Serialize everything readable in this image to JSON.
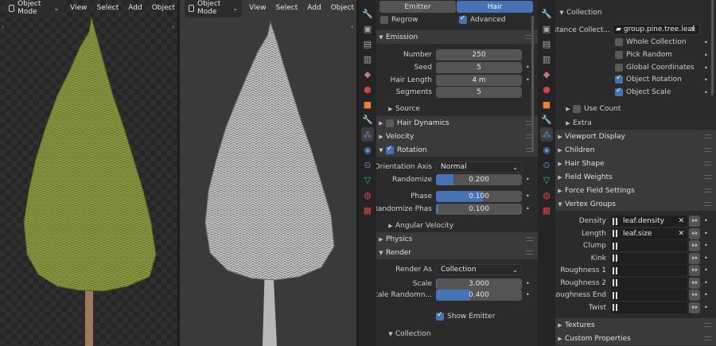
{
  "viewport_left": {
    "header": {
      "mode": "Object Mode",
      "menus": [
        "View",
        "Select",
        "Add",
        "Object"
      ]
    }
  },
  "viewport_right": {
    "header": {
      "mode": "Object Mode",
      "menus": [
        "View",
        "Select",
        "Add",
        "Object"
      ]
    }
  },
  "props_tabs": [
    "tool-icon",
    "render-icon",
    "output-icon",
    "view-layer-icon",
    "scene-icon",
    "world-icon",
    "object-icon",
    "modifier-icon",
    "particles-icon",
    "physics-icon",
    "constraints-icon",
    "data-icon",
    "material-icon",
    "texture-icon"
  ],
  "particles": {
    "type_tabs": {
      "emitter": "Emitter",
      "hair": "Hair"
    },
    "regrow": "Regrow",
    "advanced": "Advanced",
    "emission": {
      "title": "Emission",
      "number": {
        "label": "Number",
        "value": "250"
      },
      "seed": {
        "label": "Seed",
        "value": "5"
      },
      "hair_length": {
        "label": "Hair Length",
        "value": "4 m"
      },
      "segments": {
        "label": "Segments",
        "value": "5"
      },
      "source": "Source"
    },
    "hair_dynamics": "Hair Dynamics",
    "velocity": "Velocity",
    "rotation": {
      "title": "Rotation",
      "orientation_axis": {
        "label": "Orientation Axis",
        "value": "Normal"
      },
      "randomize": {
        "label": "Randomize",
        "value": "0.200",
        "fill": 0.2
      },
      "phase": {
        "label": "Phase",
        "value": "0.100",
        "fill": 0.55
      },
      "randomize_phase": {
        "label": "Randomize Phas",
        "value": "0.100",
        "fill": 0.03
      },
      "angular_velocity": "Angular Velocity"
    },
    "physics": "Physics",
    "render": {
      "title": "Render",
      "render_as": {
        "label": "Render As",
        "value": "Collection"
      },
      "scale": {
        "label": "Scale",
        "value": "3.000",
        "fill": 0.01
      },
      "scale_random": {
        "label": "Scale Randomn...",
        "value": "0.400",
        "fill": 0.4
      },
      "show_emitter": "Show Emitter",
      "collection": "Collection"
    }
  },
  "right": {
    "collection": {
      "title": "Collection",
      "instance_label": "Instance Collect...",
      "instance_value": "group.pine.tree.leaf",
      "whole_collection": "Whole Collection",
      "pick_random": "Pick Random",
      "global_coords": "Global Coordinates",
      "object_rotation": "Object Rotation",
      "object_scale": "Object Scale",
      "use_count": "Use Count",
      "extra": "Extra"
    },
    "sections": [
      "Viewport Display",
      "Children",
      "Hair Shape",
      "Field Weights",
      "Force Field Settings"
    ],
    "vertex_groups": {
      "title": "Vertex Groups",
      "rows": [
        {
          "label": "Density",
          "value": "leaf.density"
        },
        {
          "label": "Length",
          "value": "leaf.size"
        },
        {
          "label": "Clump",
          "value": ""
        },
        {
          "label": "Kink",
          "value": ""
        },
        {
          "label": "Roughness 1",
          "value": ""
        },
        {
          "label": "Roughness 2",
          "value": ""
        },
        {
          "label": "Roughness End",
          "value": ""
        },
        {
          "label": "Twist",
          "value": ""
        }
      ]
    },
    "textures": "Textures",
    "custom_properties": "Custom Properties"
  },
  "colors": {
    "accent": "#4772b3",
    "panel": "#2b2b2b",
    "header": "#3a3a3a"
  }
}
